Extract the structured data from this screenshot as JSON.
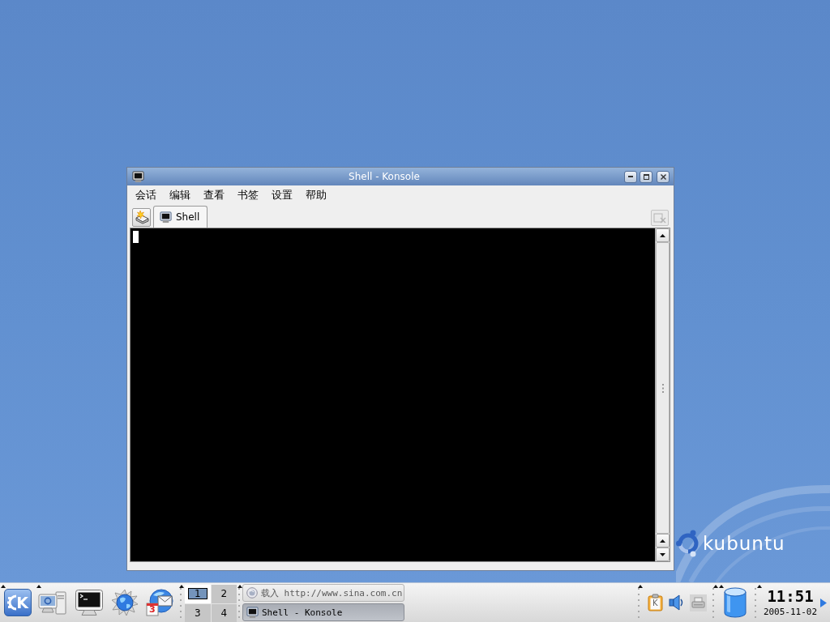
{
  "desktop": {
    "logo_text": "kubuntu"
  },
  "window": {
    "title": "Shell - Konsole",
    "menu": [
      "会话",
      "编辑",
      "查看",
      "书签",
      "设置",
      "帮助"
    ],
    "tabs": [
      {
        "label": "Shell",
        "selected": true
      }
    ],
    "close_tab": {
      "disabled": true
    }
  },
  "taskbar": {
    "k_menu": {
      "label": "K"
    },
    "mail_launcher": {
      "badge": "3"
    },
    "pager": [
      {
        "label": "1",
        "selected": true
      },
      {
        "label": "2",
        "selected": false
      },
      {
        "label": "3",
        "selected": false
      },
      {
        "label": "4",
        "selected": false
      }
    ],
    "tasks": [
      {
        "kind": "browser",
        "label": "载入 http://www.sina.com.cn",
        "selected": false
      },
      {
        "kind": "terminal",
        "label": "Shell - Konsole",
        "selected": true
      }
    ],
    "clipboard": {
      "label": "K"
    },
    "clock": {
      "time": "11:51",
      "date": "2005-11-02"
    }
  }
}
